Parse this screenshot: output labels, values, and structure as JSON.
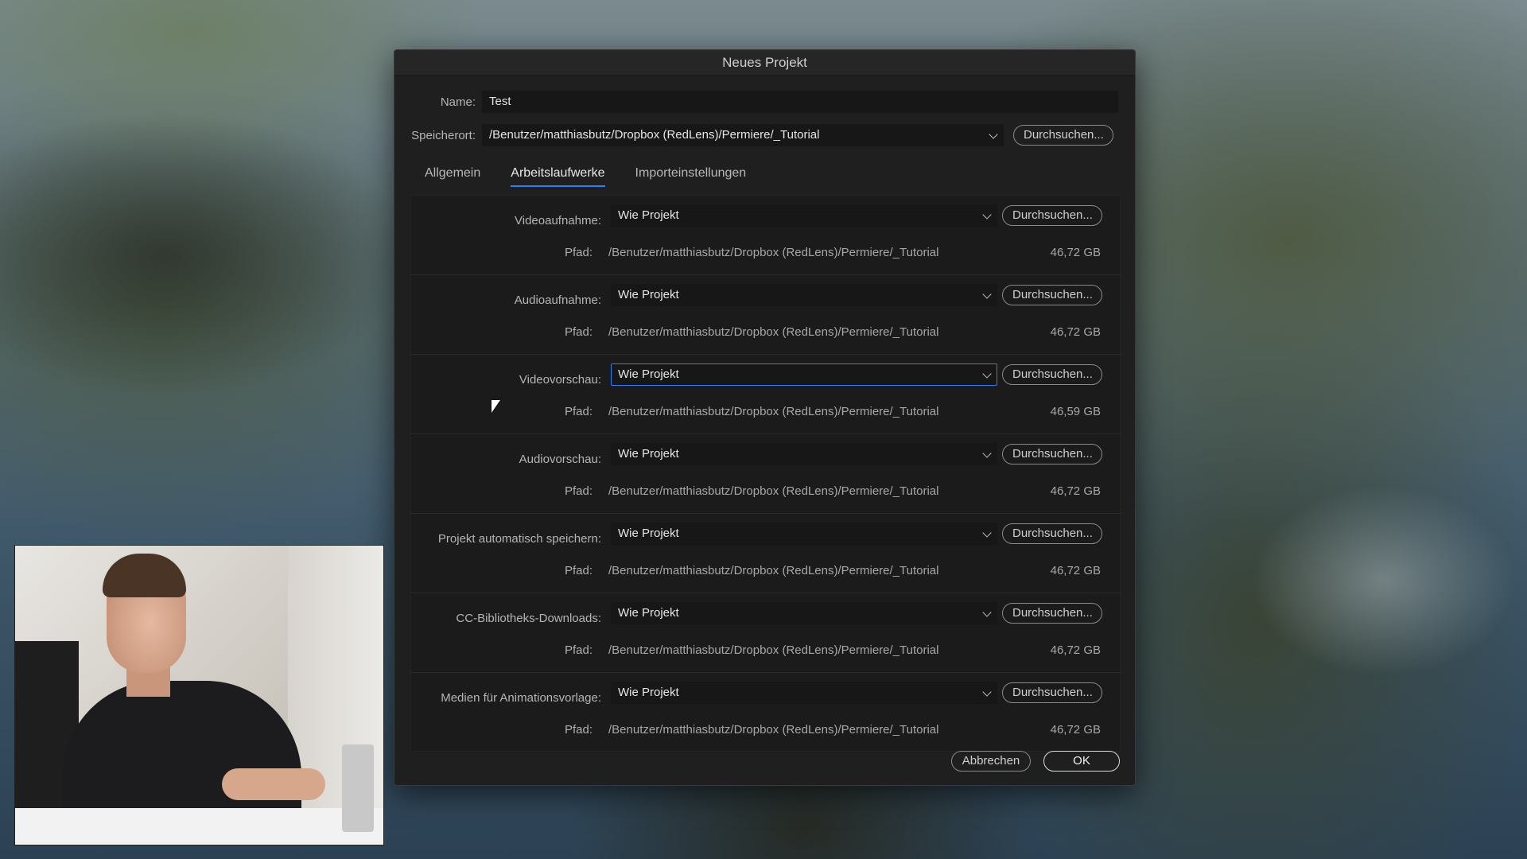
{
  "dialog": {
    "title": "Neues Projekt",
    "name_label": "Name:",
    "name_value": "Test",
    "location_label": "Speicherort:",
    "location_value": "/Benutzer/matthiasbutz/Dropbox (RedLens)/Permiere/_Tutorial",
    "browse_label": "Durchsuchen...",
    "tabs": [
      {
        "label": "Allgemein",
        "active": false
      },
      {
        "label": "Arbeitslaufwerke",
        "active": true
      },
      {
        "label": "Importeinstellungen",
        "active": false
      }
    ],
    "path_label": "Pfad:",
    "sections": [
      {
        "label": "Videoaufnahme:",
        "value": "Wie Projekt",
        "path": "/Benutzer/matthiasbutz/Dropbox (RedLens)/Permiere/_Tutorial",
        "size": "46,72 GB",
        "browse": "Durchsuchen..."
      },
      {
        "label": "Audioaufnahme:",
        "value": "Wie Projekt",
        "path": "/Benutzer/matthiasbutz/Dropbox (RedLens)/Permiere/_Tutorial",
        "size": "46,72 GB",
        "browse": "Durchsuchen..."
      },
      {
        "label": "Videovorschau:",
        "value": "Wie Projekt",
        "path": "/Benutzer/matthiasbutz/Dropbox (RedLens)/Permiere/_Tutorial",
        "size": "46,59 GB",
        "browse": "Durchsuchen..."
      },
      {
        "label": "Audiovorschau:",
        "value": "Wie Projekt",
        "path": "/Benutzer/matthiasbutz/Dropbox (RedLens)/Permiere/_Tutorial",
        "size": "46,72 GB",
        "browse": "Durchsuchen..."
      },
      {
        "label": "Projekt automatisch speichern:",
        "value": "Wie Projekt",
        "path": "/Benutzer/matthiasbutz/Dropbox (RedLens)/Permiere/_Tutorial",
        "size": "46,72 GB",
        "browse": "Durchsuchen..."
      },
      {
        "label": "CC-Bibliotheks-Downloads:",
        "value": "Wie Projekt",
        "path": "/Benutzer/matthiasbutz/Dropbox (RedLens)/Permiere/_Tutorial",
        "size": "46,72 GB",
        "browse": "Durchsuchen..."
      },
      {
        "label": "Medien für Animationsvorlage:",
        "value": "Wie Projekt",
        "path": "/Benutzer/matthiasbutz/Dropbox (RedLens)/Permiere/_Tutorial",
        "size": "46,72 GB",
        "browse": "Durchsuchen..."
      }
    ],
    "cancel_label": "Abbrechen",
    "ok_label": "OK"
  },
  "colors": {
    "accent": "#2d7ff9",
    "dialog_bg": "#1f1f1f"
  },
  "icons": [
    "chevron-down-icon",
    "mouse-cursor-icon"
  ]
}
